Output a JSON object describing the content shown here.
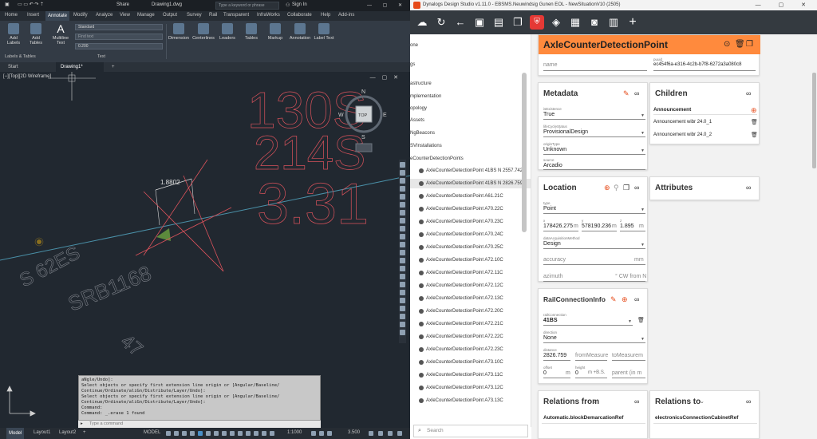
{
  "cad": {
    "file_name": "Drawing1.dwg",
    "share_label": "Share",
    "search_placeholder": "Type a keyword or phrase",
    "sign_in_label": "Sign In",
    "ribbon_tabs": [
      "Home",
      "Insert",
      "Annotate",
      "Modify",
      "Analyze",
      "View",
      "Manage",
      "Output",
      "Survey",
      "Rail",
      "Transparent",
      "InfraWorks",
      "Collaborate",
      "Help",
      "Add-ins"
    ],
    "active_ribbon_tab": "Annotate",
    "ribbon_buttons": [
      {
        "label": "Add Labels",
        "icon": "labels-icon"
      },
      {
        "label": "Add Tables",
        "icon": "tables-icon"
      },
      {
        "label": "Multiline Text",
        "icon": "text-icon"
      },
      {
        "label": "Dimension",
        "icon": "dimension-icon"
      },
      {
        "label": "Centerlines",
        "icon": "centerline-icon"
      },
      {
        "label": "Leaders",
        "icon": "leader-icon"
      },
      {
        "label": "Tables",
        "icon": "table-icon"
      },
      {
        "label": "Markup",
        "icon": "markup-icon"
      },
      {
        "label": "Annotation",
        "icon": "annotation-icon"
      },
      {
        "label": "Label Text",
        "icon": "label-text-icon"
      }
    ],
    "style_value": "Standard",
    "find_text_placeholder": "Find text",
    "text_height": "0.200",
    "group_labels": [
      "Labels & Tables",
      "Text"
    ],
    "doc_tabs": [
      "Start",
      "Drawing1*"
    ],
    "active_doc_tab": "Drawing1*",
    "viewport_label": "[−][Top][2D Wireframe]",
    "viewcube": {
      "top": "TOP",
      "n": "N",
      "s": "S",
      "e": "E",
      "w": "W"
    },
    "dimension_value": "1.8802",
    "drawing_texts": [
      "130S",
      "214S",
      "3.31",
      "S 62ES",
      "SRB1168",
      "47"
    ],
    "command_lines": [
      "aNgle/Undo]:",
      "Select objects or specify first extension line origin or [Angular/Baseline/",
      "Continue/Ordinate/aliGn/Distribute/Layer/Undo]:",
      "Select objects or specify first extension line origin or [Angular/Baseline/",
      "Continue/Ordinate/aliGn/Distribute/Layer/Undo]:",
      "Command:",
      "Command: _.erase 1 found"
    ],
    "command_placeholder": "Type a command",
    "layout_tabs": [
      "Model",
      "Layout1",
      "Layout2"
    ],
    "active_layout_tab": "Model",
    "status_mode": "MODEL",
    "scale": "1:1000",
    "units_value": "3.500",
    "colors": {
      "background": "#212830",
      "red_lines": "#d9525b",
      "cyan_line": "#4a90a8",
      "green": "#5c8a3c"
    }
  },
  "ds": {
    "window_title": "Dynalogs Design Studio v1.11.0 - EBSMS.Neuwindsig Gunen EOL - NewSituationV10 (2505)",
    "toolbar_icons": [
      "cloud-upload-icon",
      "refresh-icon",
      "back-icon",
      "save-icon",
      "save-as-icon",
      "shield-icon",
      "layers-icon",
      "map-icon",
      "camera-icon",
      "sidebar-icon",
      "add-icon"
    ],
    "tree_items": [
      {
        "label": "one",
        "dot": false
      },
      {
        "label": "gs",
        "dot": false
      },
      {
        "label": "astructure",
        "dot": false
      },
      {
        "label": "mplementation",
        "dot": false
      },
      {
        "label": "opology",
        "dot": false
      },
      {
        "label": "Assets",
        "dot": false
      },
      {
        "label": "NgBeacons",
        "dot": false
      },
      {
        "label": "SVInstallations",
        "dot": false
      },
      {
        "label": "eCounterDetectionPoints",
        "dot": false
      },
      {
        "label": "AxleCounterDetectionPoint 41BS N 2557.742",
        "dot": true
      },
      {
        "label": "AxleCounterDetectionPoint 41BS N 2826.759",
        "dot": true,
        "selected": true
      },
      {
        "label": "AxleCounterDetectionPoint A61.21C",
        "dot": true
      },
      {
        "label": "AxleCounterDetectionPoint A70.22C",
        "dot": true
      },
      {
        "label": "AxleCounterDetectionPoint A70.23C",
        "dot": true
      },
      {
        "label": "AxleCounterDetectionPoint A70.24C",
        "dot": true
      },
      {
        "label": "AxleCounterDetectionPoint A70.25C",
        "dot": true
      },
      {
        "label": "AxleCounterDetectionPoint A72.10C",
        "dot": true
      },
      {
        "label": "AxleCounterDetectionPoint A72.11C",
        "dot": true
      },
      {
        "label": "AxleCounterDetectionPoint A72.12C",
        "dot": true
      },
      {
        "label": "AxleCounterDetectionPoint A72.13C",
        "dot": true
      },
      {
        "label": "AxleCounterDetectionPoint A72.20C",
        "dot": true
      },
      {
        "label": "AxleCounterDetectionPoint A72.21C",
        "dot": true
      },
      {
        "label": "AxleCounterDetectionPoint A72.22C",
        "dot": true
      },
      {
        "label": "AxleCounterDetectionPoint A72.23C",
        "dot": true
      },
      {
        "label": "AxleCounterDetectionPoint A73.10C",
        "dot": true
      },
      {
        "label": "AxleCounterDetectionPoint A73.11C",
        "dot": true
      },
      {
        "label": "AxleCounterDetectionPoint A73.12C",
        "dot": true
      },
      {
        "label": "AxleCounterDetectionPoint A73.13C",
        "dot": true
      }
    ],
    "search_placeholder": "Search",
    "header": {
      "title": "AxleCounterDetectionPoint",
      "name_placeholder": "name",
      "puuid_label": "puuid",
      "puuid_value": "ec454f6a-e316-4c2b-b7f8-6272a3a080c8"
    },
    "metadata": {
      "title": "Metadata",
      "fields": [
        {
          "label": "isExistence",
          "value": "True"
        },
        {
          "label": "lifeCycleStatus",
          "value": "ProvisionalDesign"
        },
        {
          "label": "originType",
          "value": "Unknown"
        },
        {
          "label": "source",
          "value": "Arcadio"
        }
      ]
    },
    "children": {
      "title": "Children",
      "group": "Announcement",
      "items": [
        "Announcement wibr 24.0_1",
        "Announcement wibr 24.0_2"
      ]
    },
    "location": {
      "title": "Location",
      "type_label": "type",
      "type_value": "Point",
      "x_label": "x",
      "x_value": "178426.275",
      "x_unit": "m",
      "y_label": "y",
      "y_value": "578190.236",
      "y_unit": "m",
      "z_label": "z",
      "z_value": "1.895",
      "z_unit": "m",
      "method_label": "dataAcquisitionMethod",
      "method_value": "Design",
      "accuracy_placeholder": "accuracy",
      "accuracy_unit": "mm",
      "azimuth_placeholder": "azimuth",
      "azimuth_unit": "° CW from N"
    },
    "attributes": {
      "title": "Attributes"
    },
    "rail_connection": {
      "title": "RailConnectionInfo",
      "rail_label": "railConnection",
      "rail_value": "41BS",
      "direction_label": "direction",
      "direction_value": "None",
      "distance_label": "distance",
      "distance_value": "2826.759",
      "from_placeholder": "fromMeasure",
      "to_placeholder": "toMeasurem",
      "offset_label": "offset",
      "offset_value": "0",
      "offset_unit": "m",
      "height_label": "height",
      "height_value": "0",
      "height_unit": "m +B.S.",
      "parent_placeholder": "parent (in m"
    },
    "relations_from": {
      "title": "Relations from",
      "value": "Automatic.blockDemarcationRef"
    },
    "relations_to": {
      "title": "Relations to",
      "value": "electronicsConnectionCabinetRef"
    },
    "colors": {
      "accent": "#ff7d3b",
      "toolbar": "#343a40",
      "header_bg": "#ff8a3d"
    }
  }
}
